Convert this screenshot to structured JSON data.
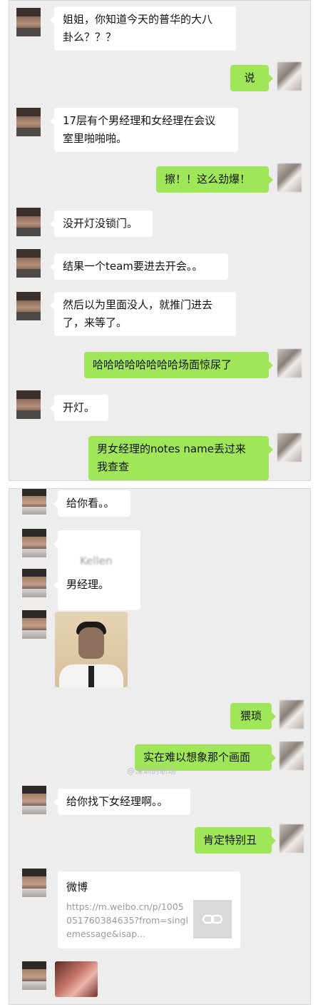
{
  "panel1": {
    "messages": [
      {
        "side": "in",
        "text": "姐姐，你知道今天的普华的大八\n卦么？？？"
      },
      {
        "side": "out",
        "text": "说"
      },
      {
        "side": "in",
        "text": "17层有个男经理和女经理在会议\n室里啪啪啪。"
      },
      {
        "side": "out",
        "text": "擦！！这么劲爆！"
      },
      {
        "side": "in",
        "text": "没开灯没锁门。"
      },
      {
        "side": "in",
        "text": "结果一个team要进去开会。。"
      },
      {
        "side": "in",
        "text": "然后以为里面没人，就推门进去\n了，来等了。"
      },
      {
        "side": "out",
        "text": "哈哈哈哈哈哈哈哈场面惊尿了"
      },
      {
        "side": "in",
        "text": "开灯。"
      },
      {
        "side": "out",
        "text": "男女经理的notes name丢过来\n我查查"
      }
    ]
  },
  "panel2": {
    "messages": [
      {
        "side": "in",
        "text": "给你看。。"
      },
      {
        "side": "in",
        "text": "Kellen Tang"
      },
      {
        "side": "in",
        "text": "男经理。"
      },
      {
        "side": "out",
        "text": "猥琐"
      },
      {
        "side": "out",
        "text": "实在难以想象那个画面"
      },
      {
        "side": "in",
        "text": "给你找下女经理啊。。"
      },
      {
        "side": "out",
        "text": "肯定特别丑"
      }
    ],
    "link_card": {
      "title": "微博",
      "desc": "https://m.weibo.cn/p/1005051760384635?from=singlemessage&isap..."
    },
    "watermark": "@深圳的职场"
  },
  "icons": {
    "link_thumb": "link-chain-icon"
  }
}
